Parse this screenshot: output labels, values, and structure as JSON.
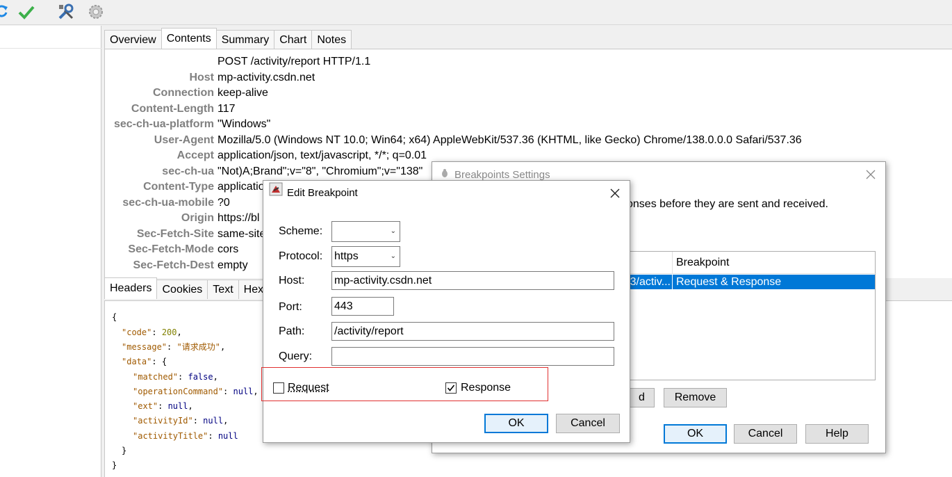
{
  "toolbar": {
    "icons": [
      "refresh-icon",
      "checkmark-icon",
      "tools-icon",
      "gear-icon"
    ]
  },
  "tabs_top": [
    "Overview",
    "Contents",
    "Summary",
    "Chart",
    "Notes"
  ],
  "request": {
    "request_line": "POST /activity/report HTTP/1.1",
    "headers": [
      {
        "key": "Host",
        "value": "mp-activity.csdn.net"
      },
      {
        "key": "Connection",
        "value": "keep-alive"
      },
      {
        "key": "Content-Length",
        "value": "117"
      },
      {
        "key": "sec-ch-ua-platform",
        "value": "\"Windows\""
      },
      {
        "key": "User-Agent",
        "value": "Mozilla/5.0 (Windows NT 10.0; Win64; x64) AppleWebKit/537.36 (KHTML, like Gecko) Chrome/138.0.0.0 Safari/537.36"
      },
      {
        "key": "Accept",
        "value": "application/json, text/javascript, */*; q=0.01"
      },
      {
        "key": "sec-ch-ua",
        "value": "\"Not)A;Brand\";v=\"8\", \"Chromium\";v=\"138\""
      },
      {
        "key": "Content-Type",
        "value": "applicatio"
      },
      {
        "key": "sec-ch-ua-mobile",
        "value": "?0"
      },
      {
        "key": "Origin",
        "value": "https://bl"
      },
      {
        "key": "Sec-Fetch-Site",
        "value": "same-site"
      },
      {
        "key": "Sec-Fetch-Mode",
        "value": "cors"
      },
      {
        "key": "Sec-Fetch-Dest",
        "value": "empty"
      }
    ]
  },
  "tabs_bottom": [
    "Headers",
    "Cookies",
    "Text",
    "Hex"
  ],
  "response_json": {
    "open": "{",
    "code_key": "\"code\"",
    "code_val": "200",
    "message_key": "\"message\"",
    "message_val": "\"请求成功\"",
    "data_key": "\"data\"",
    "data_open": "{",
    "matched_key": "\"matched\"",
    "matched_val": "false",
    "opcmd_key": "\"operationCommand\"",
    "opcmd_val": "null",
    "ext_key": "\"ext\"",
    "ext_val": "null",
    "activityId_key": "\"activityId\"",
    "activityId_val": "null",
    "activityTitle_key": "\"activityTitle\"",
    "activityTitle_val": "null",
    "data_close": "}",
    "close": "}"
  },
  "bp_settings": {
    "title": "Breakpoints Settings",
    "description_fragment": "onses before they are sent and received.",
    "column_header": "Breakpoint",
    "row_left": "3/activ...",
    "row_right": "Request & Response",
    "add_fragment": "d",
    "remove": "Remove",
    "ok": "OK",
    "cancel": "Cancel",
    "help": "Help"
  },
  "edit_bp": {
    "title": "Edit Breakpoint",
    "scheme_label": "Scheme:",
    "scheme_value": "",
    "protocol_label": "Protocol:",
    "protocol_value": "https",
    "host_label": "Host:",
    "host_value": "mp-activity.csdn.net",
    "port_label": "Port:",
    "port_value": "443",
    "path_label": "Path:",
    "path_value": "/activity/report",
    "query_label": "Query:",
    "query_value": "",
    "request_label": "Request",
    "request_checked": false,
    "response_label": "Response",
    "response_checked": true,
    "ok": "OK",
    "cancel": "Cancel"
  },
  "colors": {
    "highlight": "#e03030",
    "selection": "#0078d7"
  }
}
